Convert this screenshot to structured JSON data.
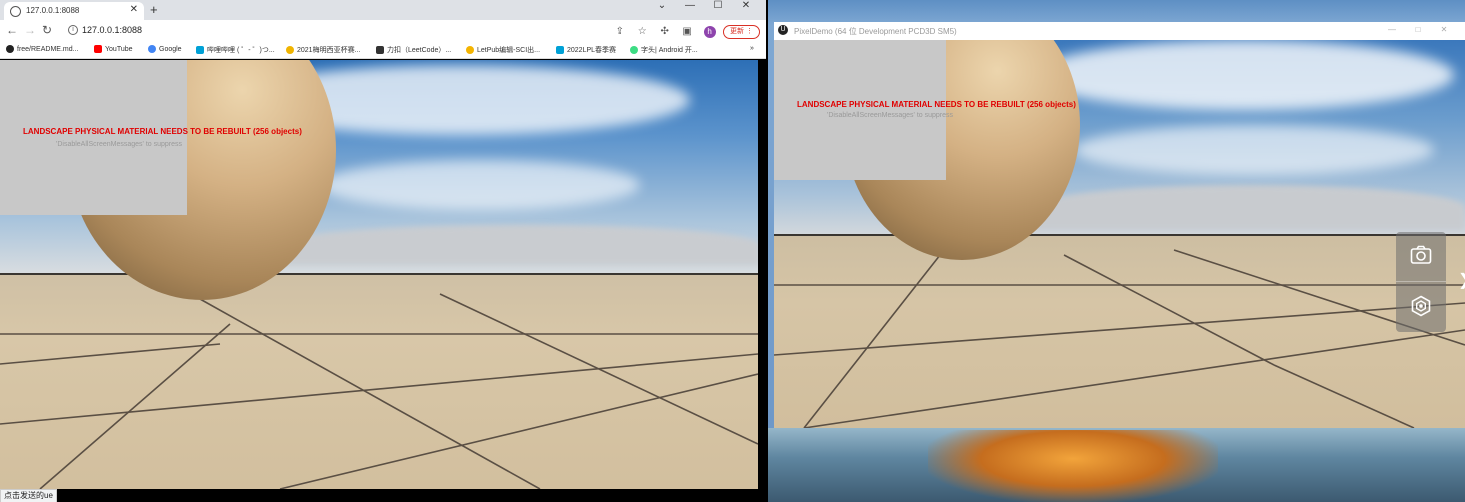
{
  "browser": {
    "tab_title": "127.0.0.1:8088",
    "url": "127.0.0.1:8088",
    "update_label": "更新",
    "avatar_letter": "h",
    "bookmarks": [
      {
        "label": "free/README.md...",
        "icon": "github-icon",
        "color": "#222222"
      },
      {
        "label": "YouTube",
        "icon": "youtube-icon",
        "color": "#ff0000"
      },
      {
        "label": "Google",
        "icon": "google-icon",
        "color": "#4285f4"
      },
      {
        "label": "哔哩哔哩 ( ゜- ゜)つ...",
        "icon": "bilibili-icon",
        "color": "#00a1d6"
      },
      {
        "label": "2021梅明西亚杯赛...",
        "icon": "emoji-icon",
        "color": "#f0b400"
      },
      {
        "label": "力扣（LeetCode）...",
        "icon": "leetcode-icon",
        "color": "#333333"
      },
      {
        "label": "LetPub编辑-SCI出...",
        "icon": "letpub-icon",
        "color": "#f4b400"
      },
      {
        "label": "2022LPL春季赛",
        "icon": "bilibili-icon",
        "color": "#00a1d6"
      },
      {
        "label": "字头| Android 开...",
        "icon": "android-icon",
        "color": "#3ddc84"
      }
    ],
    "status_text": "点击发送的ue"
  },
  "scene": {
    "warning": "LANDSCAPE PHYSICAL MATERIAL NEEDS TO BE REBUILT (256 objects)",
    "suppress": "'DisableAllScreenMessages' to suppress"
  },
  "demo": {
    "window_title": "PixelDemo (64 位 Development PCD3D SM5)",
    "window_controls": [
      "—",
      "□",
      "✕"
    ],
    "buttons": [
      {
        "name": "screenshot-button",
        "icon": "camera-icon"
      },
      {
        "name": "settings-button",
        "icon": "hexagon-settings-icon"
      }
    ]
  }
}
